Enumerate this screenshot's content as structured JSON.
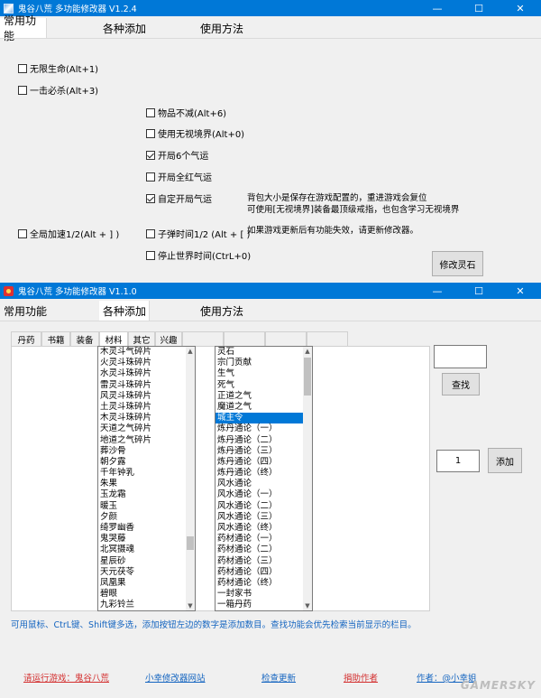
{
  "win1": {
    "title": "鬼谷八荒 多功能修改器  V1.2.4",
    "controls": {
      "minimize": "—",
      "maximize": "☐",
      "close": "✕"
    },
    "tabs": [
      "常用功能",
      "各种添加",
      "使用方法"
    ],
    "options": [
      {
        "label": "无限生命(Alt+1)",
        "checked": false
      },
      {
        "label": "一击必杀(Alt+3)",
        "checked": false
      },
      {
        "label": "物品不减(Alt+6)",
        "checked": false
      },
      {
        "label": "使用无视境界(Alt+0)",
        "checked": false
      },
      {
        "label": "开局6个气运",
        "checked": true
      },
      {
        "label": "开局全红气运",
        "checked": false
      },
      {
        "label": "自定开局气运",
        "checked": true
      },
      {
        "label": "全局加速1/2(Alt + ] )",
        "checked": false
      },
      {
        "label": "子弹时间1/2 (Alt + [ )",
        "checked": false
      },
      {
        "label": "停止世界时间(CtrL+0)",
        "checked": false
      }
    ],
    "notes": [
      "背包大小是保存在游戏配置的，重进游戏会复位",
      "可使用[无视境界]装备最顶级戒指，也包含学习无视境界",
      "如果游戏更新后有功能失效，请更新修改器。"
    ],
    "modify_button": "修改灵石"
  },
  "win2": {
    "title": "鬼谷八荒 多功能修改器  V1.1.0",
    "controls": {
      "minimize": "—",
      "maximize": "☐",
      "close": "✕"
    },
    "tabs": [
      "常用功能",
      "各种添加",
      "使用方法"
    ],
    "subtabs": [
      "丹药",
      "书籍",
      "装备",
      "材料",
      "其它",
      "兴趣"
    ],
    "materials": [
      "木灵斗气碎片",
      "火灵斗珠碎片",
      "水灵斗珠碎片",
      "雷灵斗珠碎片",
      "风灵斗珠碎片",
      "土灵斗珠碎片",
      "木灵斗珠碎片",
      "天道之气碎片",
      "地道之气碎片",
      "葬沙骨",
      "朝夕露",
      "千年钟乳",
      "朱果",
      "玉龙霜",
      "暖玉",
      "夕颜",
      "绮罗幽香",
      "鬼哭藤",
      "北冥摄魂",
      "星辰砂",
      "天元茯苓",
      "凤凰果",
      "碧眼",
      "九彩铃兰"
    ],
    "others": [
      "灵石",
      "宗门贡献",
      "生气",
      "死气",
      "正道之气",
      "魔道之气",
      "城主令",
      "炼丹通论（一）",
      "炼丹通论（二）",
      "炼丹通论（三）",
      "炼丹通论（四）",
      "炼丹通论（终）",
      "风水通论",
      "风水通论（一）",
      "风水通论（二）",
      "风水通论（三）",
      "风水通论（终）",
      "药材通论（一）",
      "药材通论（二）",
      "药材通论（三）",
      "药材通论（四）",
      "药材通论（终）",
      "一封家书",
      "一箱丹药"
    ],
    "others_selected_index": 6,
    "search_value": "",
    "search_button": "查找",
    "quantity_value": "1",
    "add_button": "添加",
    "hint": "可用鼠标、CtrL键、Shift键多选，添加按钮左边的数字是添加数目。查找功能会优先检索当前显示的栏目。",
    "footer": [
      {
        "text": "请运行游戏：鬼谷八荒",
        "color": "#d32f2f"
      },
      {
        "text": "小幸修改器网站",
        "color": "#1565c0"
      },
      {
        "text": "检查更新",
        "color": "#1565c0"
      },
      {
        "text": "捐助作者",
        "color": "#d32f2f"
      },
      {
        "text": "作者：@小幸姐",
        "color": "#1565c0"
      }
    ],
    "watermark": "GAMERSKY"
  }
}
